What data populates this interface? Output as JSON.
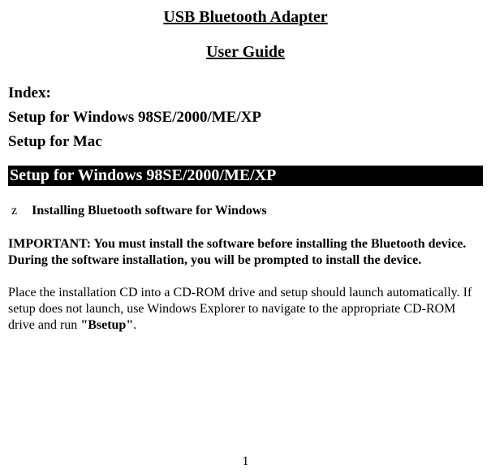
{
  "title": "USB Bluetooth Adapter",
  "subtitle": "User Guide",
  "index": {
    "heading": "Index:",
    "items": [
      "Setup for Windows 98SE/2000/ME/XP",
      "Setup for Mac"
    ]
  },
  "section_heading": "Setup for Windows 98SE/2000/ME/XP",
  "bullet": {
    "marker": "z",
    "text": "Installing Bluetooth software for Windows"
  },
  "important": "IMPORTANT: You must install the software before installing the Bluetooth device. During the software installation, you will be prompted to install the device.",
  "body": {
    "part1": "Place the installation CD into a CD-ROM drive and setup should launch automatically. If setup does not launch, use Windows Explorer to navigate to the appropriate CD-ROM drive and run ",
    "bsetup": "\"Bsetup\"",
    "part2": "."
  },
  "page_number": "1"
}
